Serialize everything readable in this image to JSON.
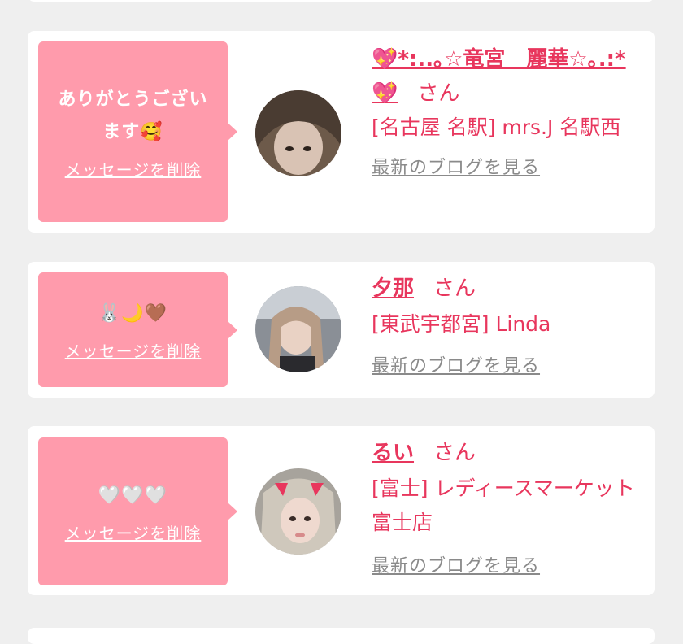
{
  "cards": [
    {
      "message": "ありがとうございます🥰",
      "delete_label": "メッセージを削除",
      "name": "💖*:..｡☆竜宮　麗華☆｡.:*💖",
      "honorific": "さん",
      "shop": "[名古屋 名駅] mrs.J 名駅西",
      "blog_link": "最新のブログを見る"
    },
    {
      "message": "🐰🌙🤎",
      "delete_label": "メッセージを削除",
      "name": "夕那",
      "honorific": "さん",
      "shop": "[東武宇都宮] Linda",
      "blog_link": "最新のブログを見る"
    },
    {
      "message": "🤍🤍🤍",
      "delete_label": "メッセージを削除",
      "name": "るい",
      "honorific": "さん",
      "shop": "[富士] レディースマーケット 富士店",
      "blog_link": "最新のブログを見る"
    }
  ],
  "colors": {
    "bubble": "#ff9bac",
    "accent": "#e8365d",
    "link_gray": "#8a8a8a",
    "background": "#efefef"
  }
}
